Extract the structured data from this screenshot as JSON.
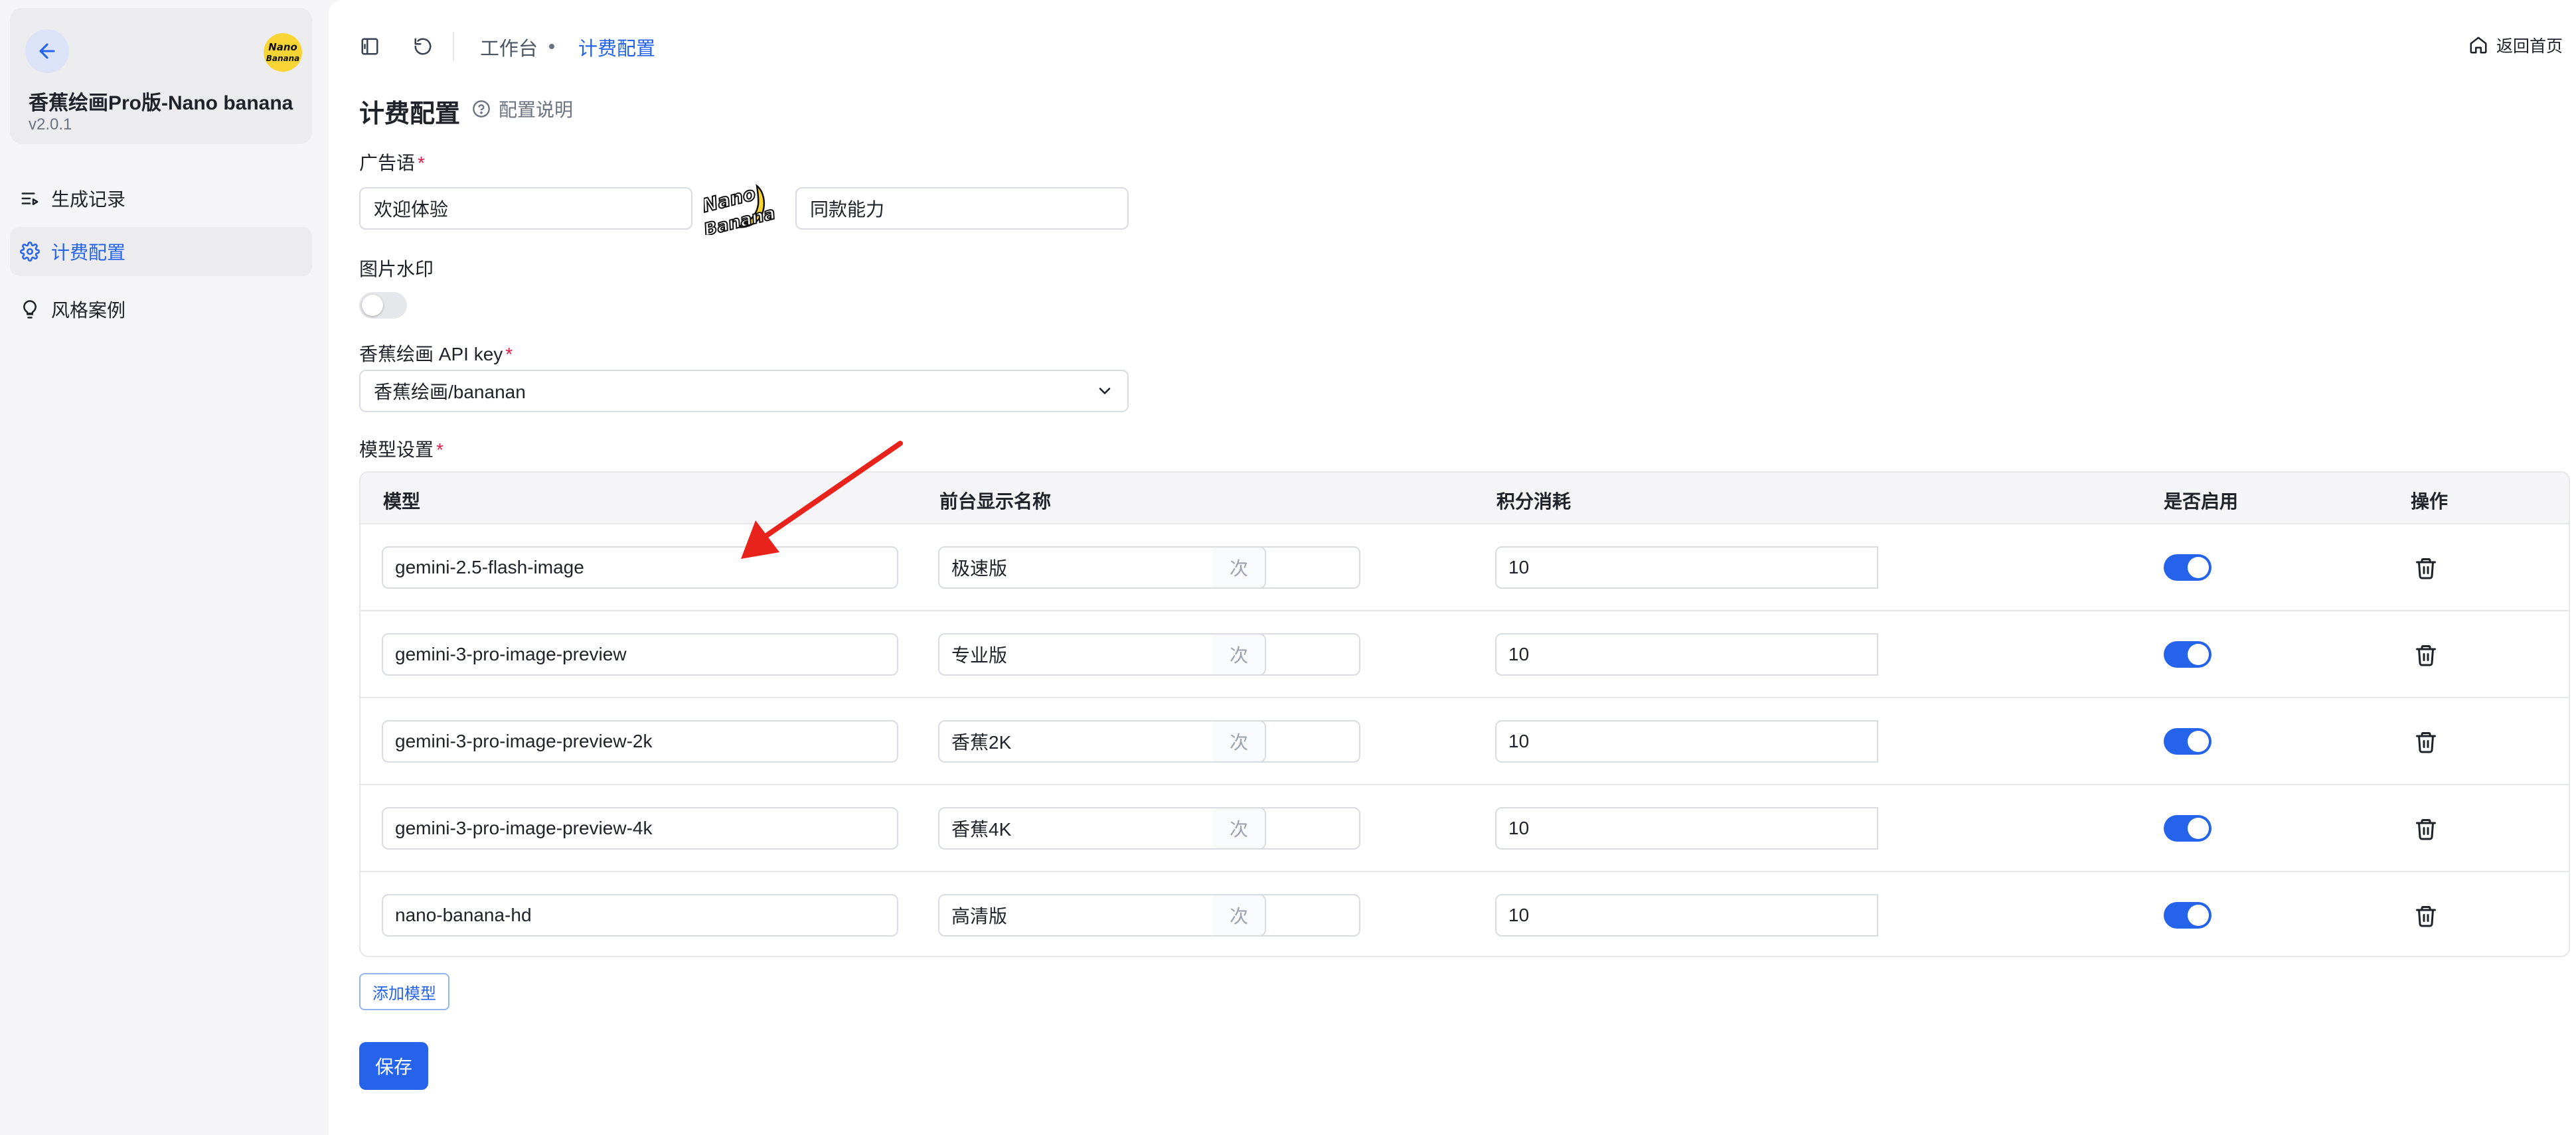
{
  "app": {
    "title": "香蕉绘画Pro版-Nano banana",
    "version": "v2.0.1",
    "logo_text": "Nano Banana"
  },
  "sidebar": {
    "items": [
      {
        "label": "生成记录",
        "icon": "list-play-icon",
        "active": false
      },
      {
        "label": "计费配置",
        "icon": "gear-icon",
        "active": true
      },
      {
        "label": "风格案例",
        "icon": "lightbulb-icon",
        "active": false
      }
    ]
  },
  "topbar": {
    "breadcrumb": [
      "工作台",
      "计费配置"
    ],
    "home_label": "返回首页"
  },
  "page": {
    "title": "计费配置",
    "help_label": "配置说明"
  },
  "form": {
    "slogan": {
      "label": "广告语",
      "value_left": "欢迎体验",
      "value_right": "同款能力",
      "logo_text": "Nano Banana"
    },
    "watermark": {
      "label": "图片水印",
      "enabled": false
    },
    "api_key": {
      "label": "香蕉绘画 API key",
      "value": "香蕉绘画/bananan"
    },
    "models": {
      "label": "模型设置",
      "columns": [
        "模型",
        "前台显示名称",
        "积分消耗",
        "是否启用",
        "操作"
      ],
      "unit": "次",
      "rows": [
        {
          "model": "gemini-2.5-flash-image",
          "display_name": "极速版",
          "cost": "10",
          "enabled": true
        },
        {
          "model": "gemini-3-pro-image-preview",
          "display_name": "专业版",
          "cost": "10",
          "enabled": true
        },
        {
          "model": "gemini-3-pro-image-preview-2k",
          "display_name": "香蕉2K",
          "cost": "10",
          "enabled": true
        },
        {
          "model": "gemini-3-pro-image-preview-4k",
          "display_name": "香蕉4K",
          "cost": "10",
          "enabled": true
        },
        {
          "model": "nano-banana-hd",
          "display_name": "高清版",
          "cost": "10",
          "enabled": true
        }
      ]
    },
    "add_model_label": "添加模型",
    "save_label": "保存"
  },
  "colors": {
    "accent": "#2563eb",
    "required": "#e11d48",
    "annotation_arrow": "#e8231c"
  }
}
